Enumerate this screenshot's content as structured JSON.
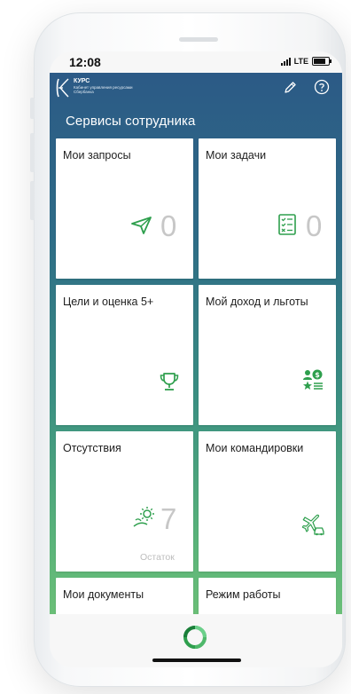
{
  "status_bar": {
    "time": "12:08",
    "network": "LTE"
  },
  "header": {
    "app_name": "КУРС",
    "app_subtitle": "Кабинет управления ресурсами Сбербанка",
    "icons": [
      "edit-icon",
      "help-icon"
    ]
  },
  "section_title": "Сервисы сотрудника",
  "tiles": [
    {
      "title": "Мои запросы",
      "icon": "send-icon",
      "count": "0"
    },
    {
      "title": "Мои задачи",
      "icon": "checklist-icon",
      "count": "0"
    },
    {
      "title": "Цели и оценка 5+",
      "icon": "trophy-icon"
    },
    {
      "title": "Мой доход и льготы",
      "icon": "income-benefits-icon"
    },
    {
      "title": "Отсутствия",
      "icon": "vacation-sun-icon",
      "count": "7",
      "caption": "Остаток"
    },
    {
      "title": "Мои командировки",
      "icon": "plane-car-icon"
    },
    {
      "title": "Мои документы"
    },
    {
      "title": "Режим работы"
    }
  ],
  "bottom_nav": {
    "icon": "sber-logo-icon"
  },
  "colors": {
    "header_top": "#2c5a86",
    "gradient_bottom": "#6bbf78",
    "accent_green": "#2e9f4d",
    "count_gray": "#c7c7c7"
  }
}
